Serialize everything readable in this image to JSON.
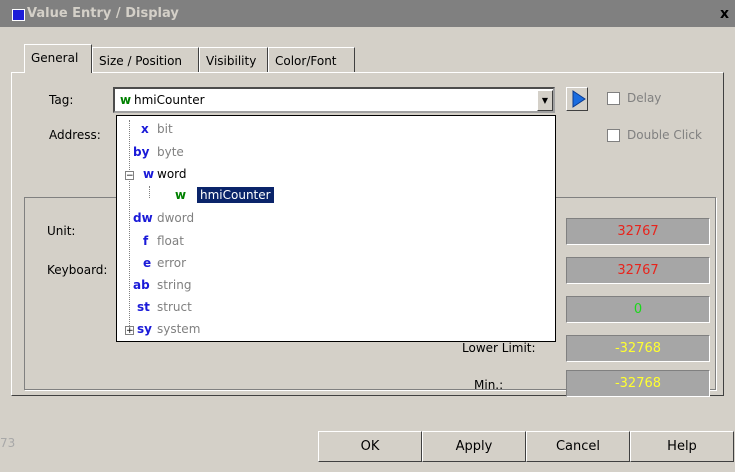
{
  "window": {
    "title": "Value Entry / Display",
    "close_label": "x"
  },
  "tabs": [
    {
      "label": "General"
    },
    {
      "label": "Size / Position"
    },
    {
      "label": "Visibility"
    },
    {
      "label": "Color/Font"
    }
  ],
  "general": {
    "tag_label": "Tag:",
    "tag_prefix": "w",
    "tag_value": "hmiCounter",
    "address_label": "Address:",
    "delay_label": "Delay",
    "double_click_label": "Double Click",
    "unit_label": "Unit:",
    "keyboard_label": "Keyboard:",
    "lower_limit_label": "Lower Limit:",
    "min_label": "Min.:",
    "values": [
      "32767",
      "32767",
      "0",
      "-32768",
      "-32768"
    ]
  },
  "colors": {
    "red_value": "#e8241c",
    "green_value": "#1ad81a",
    "yellow_value": "#ffff30"
  },
  "dropdown": {
    "items": [
      {
        "prefix": "x",
        "name": "bit"
      },
      {
        "prefix": "by",
        "name": "byte"
      },
      {
        "prefix": "w",
        "name": "word"
      },
      {
        "prefix": "w",
        "name": "hmiCounter"
      },
      {
        "prefix": "dw",
        "name": "dword"
      },
      {
        "prefix": "f",
        "name": "float"
      },
      {
        "prefix": "e",
        "name": "error"
      },
      {
        "prefix": "ab",
        "name": "string"
      },
      {
        "prefix": "st",
        "name": "struct"
      },
      {
        "prefix": "sy",
        "name": "system"
      }
    ]
  },
  "footer": {
    "status_text": "73"
  },
  "buttons": {
    "ok": "OK",
    "apply": "Apply",
    "cancel": "Cancel",
    "help": "Help"
  }
}
